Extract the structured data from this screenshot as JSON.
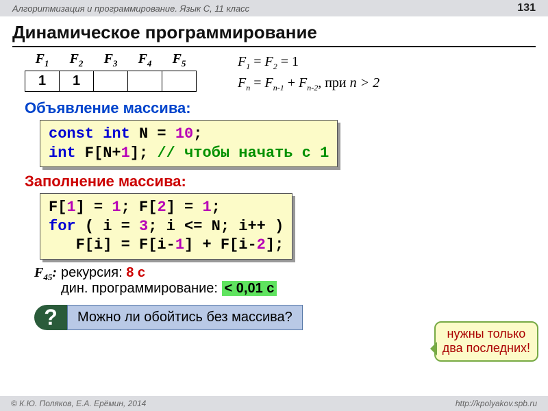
{
  "header": {
    "course": "Алгоритмизация и программирование. Язык C, 11 класс",
    "page": "131"
  },
  "title": "Динамическое программирование",
  "table": {
    "headers": [
      "F",
      "F",
      "F",
      "F",
      "F"
    ],
    "subs": [
      "1",
      "2",
      "3",
      "4",
      "5"
    ],
    "cells": [
      "1",
      "1",
      "",
      "",
      ""
    ]
  },
  "formula": {
    "line1_lhs_a": "F",
    "line1_sub_a": "1",
    "line1_eq1": " = ",
    "line1_lhs_b": "F",
    "line1_sub_b": "2",
    "line1_rhs": " = 1",
    "line2_a": "F",
    "line2_sa": "n",
    "line2_eq": " = ",
    "line2_b": "F",
    "line2_sb": "n-1",
    "line2_plus": " + ",
    "line2_c": "F",
    "line2_sc": "n-2",
    "line2_tail": ", при ",
    "line2_cond": "n > 2"
  },
  "sections": {
    "decl": "Объявление массива:",
    "fill": "Заполнение массива:"
  },
  "code1": {
    "l1a": "const int",
    "l1b": " N = ",
    "l1c": "10",
    "l1d": ";",
    "l2a": "int",
    "l2b": " F[N+",
    "l2c": "1",
    "l2d": "]; ",
    "l2e": "// чтобы начать с 1"
  },
  "code2": {
    "l1": "F[",
    "l1n1": "1",
    "l1b": "] = ",
    "l1n2": "1",
    "l1c": "; F[",
    "l1n3": "2",
    "l1d": "] = ",
    "l1n4": "1",
    "l1e": ";",
    "l2a": "for",
    "l2b": " ( i = ",
    "l2n1": "3",
    "l2c": "; i <= N; i++ )",
    "l3a": "   F[i] = F[i-",
    "l3n1": "1",
    "l3b": "] + F[i-",
    "l3n2": "2",
    "l3c": "];"
  },
  "timing": {
    "label": "F",
    "label_sub": "45",
    "colon": ":",
    "rec_lbl": "рекурсия: ",
    "rec_val": "8 с",
    "dp_lbl": "дин. программирование: ",
    "dp_val": "< 0,01 с"
  },
  "callout": {
    "l1": "нужны только",
    "l2": "два последних!"
  },
  "question": {
    "mark": "?",
    "text": "Можно ли обойтись без массива?"
  },
  "footer": {
    "left": "© К.Ю. Поляков, Е.А. Ерёмин, 2014",
    "right": "http://kpolyakov.spb.ru"
  }
}
